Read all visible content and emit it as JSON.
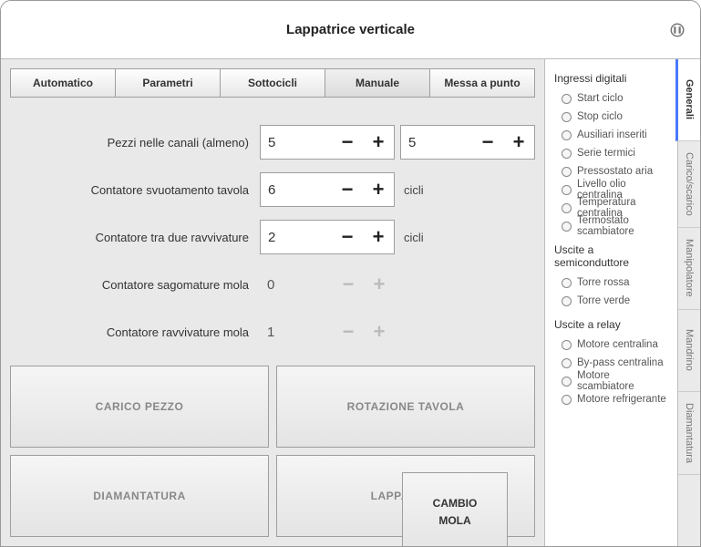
{
  "title": "Lappatrice verticale",
  "topnav": {
    "items": [
      {
        "label": "Automatico"
      },
      {
        "label": "Parametri"
      },
      {
        "label": "Sottocicli"
      },
      {
        "label": "Manuale"
      },
      {
        "label": "Messa a punto"
      }
    ],
    "active": 3
  },
  "params": {
    "row0": {
      "label": "Pezzi nelle canali (almeno)",
      "val1": "5",
      "val2": "5"
    },
    "row1": {
      "label": "Contatore svuotamento tavola",
      "val": "6",
      "unit": "cicli"
    },
    "row2": {
      "label": "Contatore tra due ravvivature",
      "val": "2",
      "unit": "cicli"
    },
    "row3": {
      "label": "Contatore sagomature mola",
      "val": "0"
    },
    "row4": {
      "label": "Contatore ravvivature mola",
      "val": "1"
    }
  },
  "cambio_mola": "CAMBIO\nMOLA",
  "bigbtns": {
    "a": "CARICO PEZZO",
    "b": "ROTAZIONE TAVOLA",
    "c": "DIAMANTATURA",
    "d": "LAPPATURA"
  },
  "io": {
    "group0": {
      "title": "Ingressi digitali",
      "items": [
        "Start ciclo",
        "Stop ciclo",
        "Ausiliari inseriti",
        "Serie termici",
        "Pressostato aria",
        "Livello olio centralina",
        "Temperatura centralina",
        "Termostato scambiatore"
      ]
    },
    "group1": {
      "title": "Uscite a semiconduttore",
      "items": [
        "Torre rossa",
        "Torre verde"
      ]
    },
    "group2": {
      "title": "Uscite a relay",
      "items": [
        "Motore centralina",
        "By-pass centralina",
        "Motore scambiatore",
        "Motore refrigerante"
      ]
    }
  },
  "vtabs": {
    "items": [
      "Generali",
      "Carico/scarico",
      "Manipolatore",
      "Mandrino",
      "Diamantatura"
    ],
    "active": 0
  }
}
